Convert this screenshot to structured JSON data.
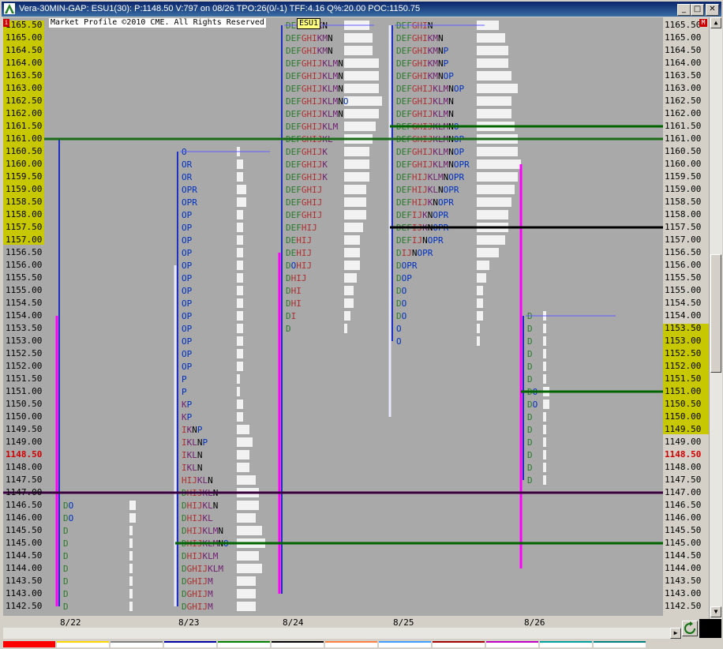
{
  "window": {
    "title": "Vera-30MIN-GAP: ESU1(30): P:1148.50 V:797 on 08/26 TPO:26(0/-1)  TFF:4.16 Q%:20.00 POC:1150.75",
    "copyright": "Market Profile ©2010 CME. All Rights Reserved",
    "symbol": "ESU1",
    "left_marker": "i",
    "right_marker": "M",
    "minimize_label": "_",
    "maximize_label": "□",
    "close_label": "✕"
  },
  "colors": {
    "plot_background": "#a9a9a9",
    "highlight_yellow": "#c8c800",
    "last_price_red": "#d00000",
    "value_area_magenta": "#ff00ff",
    "poc_black": "#000000",
    "ib_blue": "#2040c0",
    "reference_green": "#006400",
    "reference_purple": "#3a0040"
  },
  "chart_data": {
    "type": "market-profile",
    "y_axis": {
      "min": 1142.5,
      "max": 1165.5,
      "step": 0.5,
      "labels": [
        "1165.50",
        "1165.00",
        "1164.50",
        "1164.00",
        "1163.50",
        "1163.00",
        "1162.50",
        "1162.00",
        "1161.50",
        "1161.00",
        "1160.50",
        "1160.00",
        "1159.50",
        "1159.00",
        "1158.50",
        "1158.00",
        "1157.50",
        "1157.00",
        "1156.50",
        "1156.00",
        "1155.50",
        "1155.00",
        "1154.50",
        "1154.00",
        "1153.50",
        "1153.00",
        "1152.50",
        "1152.00",
        "1151.50",
        "1151.00",
        "1150.50",
        "1150.00",
        "1149.50",
        "1149.00",
        "1148.50",
        "1148.00",
        "1147.50",
        "1147.00",
        "1146.50",
        "1146.00",
        "1145.50",
        "1145.00",
        "1144.50",
        "1144.00",
        "1143.50",
        "1143.00",
        "1142.50"
      ],
      "last_price": "1148.50",
      "left_highlight_range": [
        1157.0,
        1165.5
      ],
      "right_highlight_range": [
        1149.5,
        1153.5
      ]
    },
    "x_axis": {
      "labels": [
        "8/22",
        "8/23",
        "8/24",
        "8/25",
        "8/26"
      ]
    },
    "sessions": [
      {
        "date": "8/22",
        "high": 1161.0,
        "low": 1142.5,
        "value_area_high": 1154.0,
        "value_area_low": 1142.5,
        "rows": [
          {
            "price": 1146.5,
            "letters": "DO"
          },
          {
            "price": 1146.0,
            "letters": "DO"
          },
          {
            "price": 1145.5,
            "letters": "D"
          },
          {
            "price": 1145.0,
            "letters": "D"
          },
          {
            "price": 1144.5,
            "letters": "D"
          },
          {
            "price": 1144.0,
            "letters": "D"
          },
          {
            "price": 1143.5,
            "letters": "D"
          },
          {
            "price": 1143.0,
            "letters": "D"
          },
          {
            "price": 1142.5,
            "letters": "D"
          }
        ]
      },
      {
        "date": "8/23",
        "high": 1160.5,
        "low": 1142.5,
        "value_area_high": 1156.0,
        "value_area_low": 1142.5,
        "rows": [
          {
            "price": 1160.5,
            "letters": "O"
          },
          {
            "price": 1160.0,
            "letters": "OR"
          },
          {
            "price": 1159.5,
            "letters": "OR"
          },
          {
            "price": 1159.0,
            "letters": "OPR"
          },
          {
            "price": 1158.5,
            "letters": "OPR"
          },
          {
            "price": 1158.0,
            "letters": "OP"
          },
          {
            "price": 1157.5,
            "letters": "OP"
          },
          {
            "price": 1157.0,
            "letters": "OP"
          },
          {
            "price": 1156.5,
            "letters": "OP"
          },
          {
            "price": 1156.0,
            "letters": "OP"
          },
          {
            "price": 1155.5,
            "letters": "OP"
          },
          {
            "price": 1155.0,
            "letters": "OP"
          },
          {
            "price": 1154.5,
            "letters": "OP"
          },
          {
            "price": 1154.0,
            "letters": "OP"
          },
          {
            "price": 1153.5,
            "letters": "OP"
          },
          {
            "price": 1153.0,
            "letters": "OP"
          },
          {
            "price": 1152.5,
            "letters": "OP"
          },
          {
            "price": 1152.0,
            "letters": "OP"
          },
          {
            "price": 1151.5,
            "letters": "P"
          },
          {
            "price": 1151.0,
            "letters": "P"
          },
          {
            "price": 1150.5,
            "letters": "KP"
          },
          {
            "price": 1150.0,
            "letters": "KP"
          },
          {
            "price": 1149.5,
            "letters": "IKNP"
          },
          {
            "price": 1149.0,
            "letters": "IKLNP"
          },
          {
            "price": 1148.5,
            "letters": "IKLN"
          },
          {
            "price": 1148.0,
            "letters": "IKLN"
          },
          {
            "price": 1147.5,
            "letters": "HIJKLN"
          },
          {
            "price": 1147.0,
            "letters": "DHIJKLN"
          },
          {
            "price": 1146.5,
            "letters": "DHIJKLN"
          },
          {
            "price": 1146.0,
            "letters": "DHIJKL"
          },
          {
            "price": 1145.5,
            "letters": "DHIJKLMN"
          },
          {
            "price": 1145.0,
            "letters": "DHIJKLMNO"
          },
          {
            "price": 1144.5,
            "letters": "DHIJKLM"
          },
          {
            "price": 1144.0,
            "letters": "DGHIJKLM"
          },
          {
            "price": 1143.5,
            "letters": "DGHIJM"
          },
          {
            "price": 1143.0,
            "letters": "DGHIJM"
          },
          {
            "price": 1142.5,
            "letters": "DGHIJM"
          }
        ]
      },
      {
        "date": "8/24",
        "high": 1165.5,
        "low": 1143.0,
        "value_area_high": 1156.5,
        "value_area_low": 1143.0,
        "rows": [
          {
            "price": 1165.5,
            "letters": "DEFGHIKN"
          },
          {
            "price": 1165.0,
            "letters": "DEFGHIKMN"
          },
          {
            "price": 1164.5,
            "letters": "DEFGHIKMN"
          },
          {
            "price": 1164.0,
            "letters": "DEFGHIJKLMN"
          },
          {
            "price": 1163.5,
            "letters": "DEFGHIJKLMN"
          },
          {
            "price": 1163.0,
            "letters": "DEFGHIJKLMN"
          },
          {
            "price": 1162.5,
            "letters": "DEFGHIJKLMNO"
          },
          {
            "price": 1162.0,
            "letters": "DEFGHIJKLMN"
          },
          {
            "price": 1161.5,
            "letters": "DEFGHIJKLM"
          },
          {
            "price": 1161.0,
            "letters": "DEFGHIJKL"
          },
          {
            "price": 1160.5,
            "letters": "DEFGHIJK"
          },
          {
            "price": 1160.0,
            "letters": "DEFGHIJK"
          },
          {
            "price": 1159.5,
            "letters": "DEFGHIJK"
          },
          {
            "price": 1159.0,
            "letters": "DEFGHIJ"
          },
          {
            "price": 1158.5,
            "letters": "DEFGHIJ"
          },
          {
            "price": 1158.0,
            "letters": "DEFGHIJ"
          },
          {
            "price": 1157.5,
            "letters": "DEFHIJ"
          },
          {
            "price": 1157.0,
            "letters": "DEHIJ"
          },
          {
            "price": 1156.5,
            "letters": "DEHIJ"
          },
          {
            "price": 1156.0,
            "letters": "DOHIJ"
          },
          {
            "price": 1155.5,
            "letters": "DHIJ"
          },
          {
            "price": 1155.0,
            "letters": "DHI"
          },
          {
            "price": 1154.5,
            "letters": "DHI"
          },
          {
            "price": 1154.0,
            "letters": "DI"
          },
          {
            "price": 1153.5,
            "letters": "D"
          }
        ]
      },
      {
        "date": "8/25",
        "high": 1165.5,
        "low": 1153.0,
        "value_area_high": 1165.5,
        "value_area_low": 1150.0,
        "rows": [
          {
            "price": 1165.5,
            "letters": "DEFGHIN"
          },
          {
            "price": 1165.0,
            "letters": "DEFGHIKMN"
          },
          {
            "price": 1164.5,
            "letters": "DEFGHIKMNP"
          },
          {
            "price": 1164.0,
            "letters": "DEFGHIKMNP"
          },
          {
            "price": 1163.5,
            "letters": "DEFGHIKMNOP"
          },
          {
            "price": 1163.0,
            "letters": "DEFGHIJKLMNOP"
          },
          {
            "price": 1162.5,
            "letters": "DEFGHIJKLMN"
          },
          {
            "price": 1162.0,
            "letters": "DEFGHIJKLMN"
          },
          {
            "price": 1161.5,
            "letters": "DEFGHIJKLMNO"
          },
          {
            "price": 1161.0,
            "letters": "DEFGHIJKLMNOP"
          },
          {
            "price": 1160.5,
            "letters": "DEFGHIJKLMNOP"
          },
          {
            "price": 1160.0,
            "letters": "DEFGHIJKLMNOPR"
          },
          {
            "price": 1159.5,
            "letters": "DEFHIJKLMNOPR"
          },
          {
            "price": 1159.0,
            "letters": "DEFHIJKLNOPR"
          },
          {
            "price": 1158.5,
            "letters": "DEFHIJKNOPR"
          },
          {
            "price": 1158.0,
            "letters": "DEFIJKNOPR"
          },
          {
            "price": 1157.5,
            "letters": "DEFIJKNOPR"
          },
          {
            "price": 1157.0,
            "letters": "DEFIJNOPR"
          },
          {
            "price": 1156.5,
            "letters": "DIJNOPR"
          },
          {
            "price": 1156.0,
            "letters": "DOPR"
          },
          {
            "price": 1155.5,
            "letters": "DOP"
          },
          {
            "price": 1155.0,
            "letters": "DO"
          },
          {
            "price": 1154.5,
            "letters": "DO"
          },
          {
            "price": 1154.0,
            "letters": "DO"
          },
          {
            "price": 1153.5,
            "letters": "O"
          },
          {
            "price": 1153.0,
            "letters": "O"
          }
        ]
      },
      {
        "date": "8/26",
        "high": 1154.0,
        "low": 1147.5,
        "value_area_high": 1160.0,
        "value_area_low": 1144.0,
        "rows": [
          {
            "price": 1154.0,
            "letters": "D"
          },
          {
            "price": 1153.5,
            "letters": "D"
          },
          {
            "price": 1153.0,
            "letters": "D"
          },
          {
            "price": 1152.5,
            "letters": "D"
          },
          {
            "price": 1152.0,
            "letters": "D"
          },
          {
            "price": 1151.5,
            "letters": "D"
          },
          {
            "price": 1151.0,
            "letters": "DO"
          },
          {
            "price": 1150.5,
            "letters": "DO"
          },
          {
            "price": 1150.0,
            "letters": "D"
          },
          {
            "price": 1149.5,
            "letters": "D"
          },
          {
            "price": 1149.0,
            "letters": "D"
          },
          {
            "price": 1148.5,
            "letters": "D"
          },
          {
            "price": 1148.0,
            "letters": "D"
          },
          {
            "price": 1147.5,
            "letters": "D"
          }
        ]
      }
    ],
    "reference_lines": [
      {
        "price": 1161.0,
        "color": "#1a6b1a",
        "span": "full"
      },
      {
        "price": 1161.5,
        "color": "#006400",
        "span": "from-8/25"
      },
      {
        "price": 1157.5,
        "color": "#000000",
        "span": "from-8/25"
      },
      {
        "price": 1151.0,
        "color": "#006400",
        "span": "8/26"
      },
      {
        "price": 1147.0,
        "color": "#3a0040",
        "span": "full"
      },
      {
        "price": 1145.0,
        "color": "#006400",
        "span": "from-8/23"
      }
    ],
    "grid": false,
    "legend": "none"
  },
  "scroll": {
    "right_arrow": "▶",
    "up_arrow": "▲",
    "down_arrow": "▼"
  },
  "tabs": [
    "#ff0000",
    "#ffd700",
    "#808080",
    "#0000a0",
    "#008000",
    "#000000",
    "#ff8040",
    "#40a0ff",
    "#a00000",
    "#c000c0",
    "#00a0a0",
    "#008080"
  ]
}
